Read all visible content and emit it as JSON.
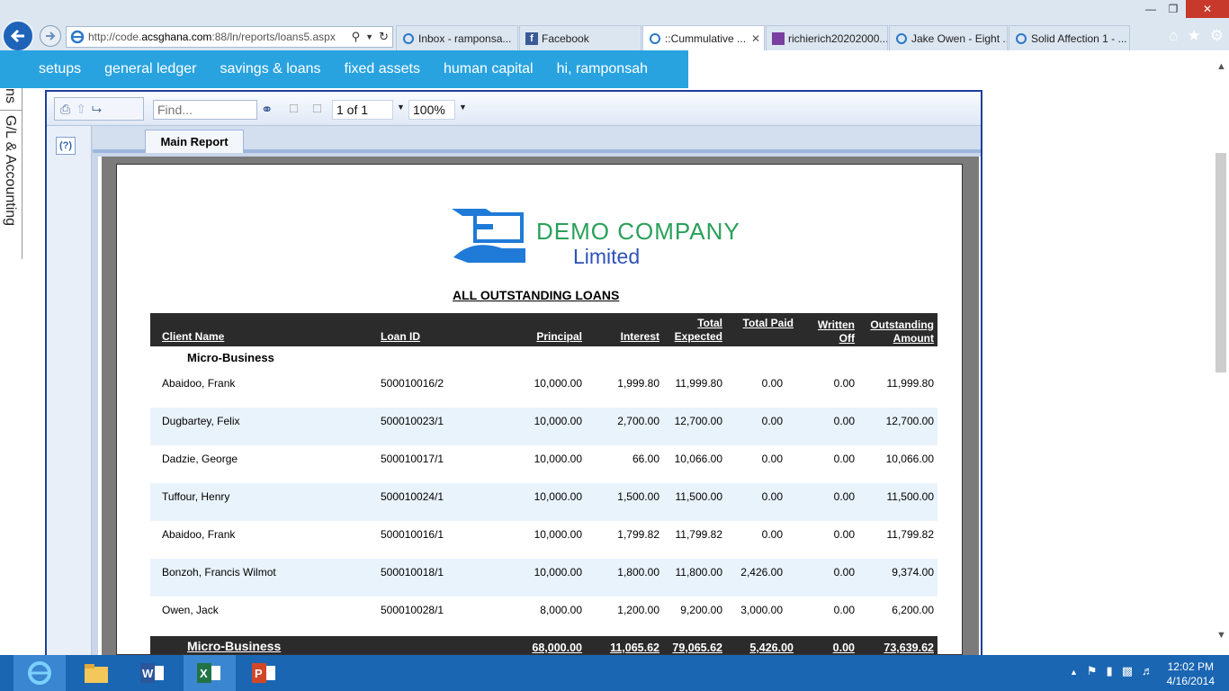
{
  "browser": {
    "address": {
      "prefix": "http://code.",
      "host": "acsghana.com",
      "suffix": ":88/ln/reports/loans5.aspx"
    },
    "tabs": [
      {
        "label": "Inbox - ramponsa..."
      },
      {
        "label": "Facebook"
      },
      {
        "label": "::Cummulative ...",
        "active": true
      },
      {
        "label": "richierich20202000..."
      },
      {
        "label": "Jake Owen - Eight ..."
      },
      {
        "label": "Solid Affection 1 - ..."
      }
    ],
    "tab_close_glyph": "✕"
  },
  "app_nav": {
    "items": [
      "setups",
      "general ledger",
      "savings & loans",
      "fixed assets",
      "human capital",
      "hi, ramponsah"
    ]
  },
  "side_panel": {
    "label": "G/L & Accounting",
    "clipped_label": "ns"
  },
  "viewer": {
    "find_placeholder": "Find...",
    "page_indicator": "1 of 1",
    "zoom": "100%",
    "help_label": "(?)",
    "tab_label": "Main Report"
  },
  "report": {
    "company_name": "DEMO COMPANY",
    "company_suffix": "Limited",
    "title": "ALL OUTSTANDING LOANS",
    "columns": {
      "client_name": "Client Name",
      "loan_id": "Loan ID",
      "principal": "Principal",
      "interest": "Interest",
      "total_expected_1": "Total",
      "total_expected_2": "Expected",
      "total_paid": "Total Paid",
      "written_off_1": "Written",
      "written_off_2": "Off",
      "outstanding_1": "Outstanding",
      "outstanding_2": "Amount"
    },
    "group_name": "Micro-Business",
    "rows": [
      {
        "client": "Abaidoo, Frank",
        "loan_id": "500010016/2",
        "principal": "10,000.00",
        "interest": "1,999.80",
        "total_expected": "11,999.80",
        "total_paid": "0.00",
        "written_off": "0.00",
        "outstanding": "11,999.80"
      },
      {
        "client": "Dugbartey, Felix",
        "loan_id": "500010023/1",
        "principal": "10,000.00",
        "interest": "2,700.00",
        "total_expected": "12,700.00",
        "total_paid": "0.00",
        "written_off": "0.00",
        "outstanding": "12,700.00"
      },
      {
        "client": "Dadzie, George",
        "loan_id": "500010017/1",
        "principal": "10,000.00",
        "interest": "66.00",
        "total_expected": "10,066.00",
        "total_paid": "0.00",
        "written_off": "0.00",
        "outstanding": "10,066.00"
      },
      {
        "client": "Tuffour, Henry",
        "loan_id": "500010024/1",
        "principal": "10,000.00",
        "interest": "1,500.00",
        "total_expected": "11,500.00",
        "total_paid": "0.00",
        "written_off": "0.00",
        "outstanding": "11,500.00"
      },
      {
        "client": "Abaidoo, Frank",
        "loan_id": "500010016/1",
        "principal": "10,000.00",
        "interest": "1,799.82",
        "total_expected": "11,799.82",
        "total_paid": "0.00",
        "written_off": "0.00",
        "outstanding": "11,799.82"
      },
      {
        "client": "Bonzoh, Francis Wilmot",
        "loan_id": "500010018/1",
        "principal": "10,000.00",
        "interest": "1,800.00",
        "total_expected": "11,800.00",
        "total_paid": "2,426.00",
        "written_off": "0.00",
        "outstanding": "9,374.00"
      },
      {
        "client": "Owen, Jack",
        "loan_id": "500010028/1",
        "principal": "8,000.00",
        "interest": "1,200.00",
        "total_expected": "9,200.00",
        "total_paid": "3,000.00",
        "written_off": "0.00",
        "outstanding": "6,200.00"
      }
    ],
    "totals": {
      "group": "Micro-Business",
      "principal": "68,000.00",
      "interest": "11,065.62",
      "total_expected": "79,065.62",
      "total_paid": "5,426.00",
      "written_off": "0.00",
      "outstanding": "73,639.62"
    }
  },
  "taskbar": {
    "time": "12:02 PM",
    "date": "4/16/2014"
  },
  "colors": {
    "app_nav_bg": "#29a3e0",
    "viewer_border": "#1e3f9a",
    "header_row_bg": "#2b2b2b",
    "alt_row_bg": "#e9f3fc",
    "logo_green": "#2aa05a",
    "logo_blue": "#2d52b8",
    "taskbar_bg": "#1a66b3"
  }
}
